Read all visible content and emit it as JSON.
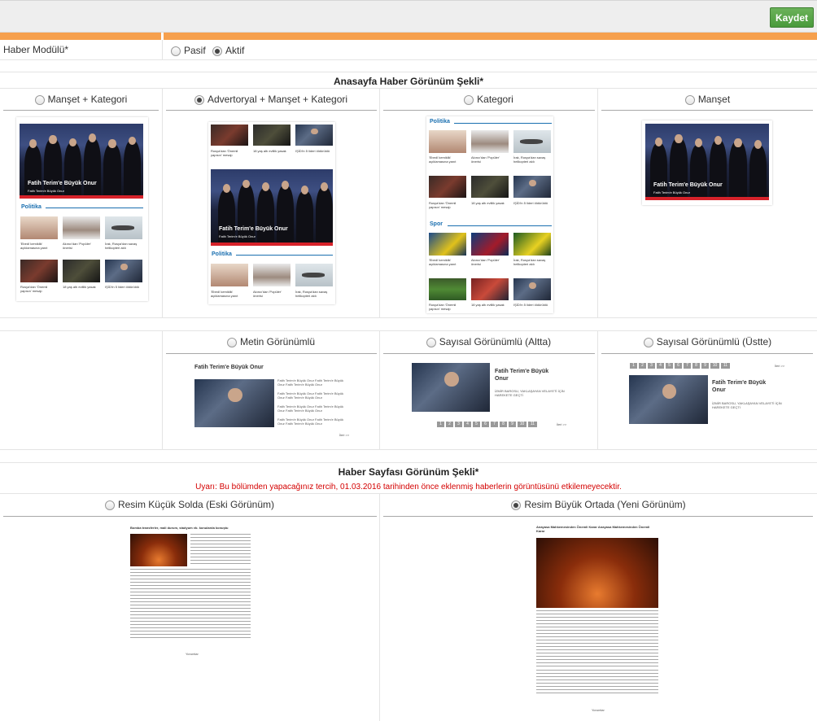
{
  "toolbar": {
    "save_label": "Kaydet"
  },
  "module": {
    "label": "Haber Modülü*",
    "options": [
      {
        "label": "Pasif",
        "selected": false
      },
      {
        "label": "Aktif",
        "selected": true
      }
    ]
  },
  "home_view": {
    "title": "Anasayfa Haber Görünüm Şekli*",
    "options": [
      {
        "label": "Manşet + Kategori",
        "selected": false
      },
      {
        "label": "Advertoryal + Manşet + Kategori",
        "selected": true
      },
      {
        "label": "Kategori",
        "selected": false
      },
      {
        "label": "Manşet",
        "selected": false
      }
    ],
    "preview": {
      "headline": "Fatih Terim'e Büyük Onur",
      "headline_sub": "Fatih Terim'e Büyük Onur",
      "categories": [
        "Politika",
        "Spor"
      ],
      "captions": [
        "'Ebedî kemiklik' açıklamasına yanıt",
        "Akıncı'dan 'Popüler' önerisi",
        "İrak, Rusya'dan savaş helikopteri aldı",
        "Rusya'dan 'Önemli yapısın' mesajı",
        "18 yaş altı evlilik yasak",
        "IŞİD'in 5 lideri öldürüldü"
      ]
    }
  },
  "pagination_view": {
    "options": [
      {
        "label": "Metin Görünümlü",
        "selected": false
      },
      {
        "label": "Sayısal Görünümlü (Altta)",
        "selected": false
      },
      {
        "label": "Sayısal Görünümlü (Üstte)",
        "selected": false
      }
    ],
    "preview": {
      "headline": "Fatih Terim'e Büyük Onur",
      "headline_two_line": [
        "Fatih Terim'e Büyük",
        "Onur"
      ],
      "list_item": "Fatih Terim'e Büyük Onur Fatih Terim'e Büyük Onur Fatih Terim'e Büyük Onur",
      "sub": "İZMİR BAROSU, YAKLAŞAYAN VELAYETİ İÇİN HAREKETE GEÇTİ",
      "next": "İleri >>",
      "pages": [
        "1",
        "2",
        "3",
        "4",
        "5",
        "6",
        "7",
        "8",
        "9",
        "10",
        "11"
      ]
    }
  },
  "news_page_view": {
    "title": "Haber Sayfası Görünüm Şekli*",
    "warning": "Uyarı: Bu bölümden yapacağınız tercih, 01.03.2016 tarihinden önce eklenmiş haberlerin görüntüsünü etkilemeyecektir.",
    "options": [
      {
        "label": "Resim Küçük Solda (Eski Görünüm)",
        "selected": false
      },
      {
        "label": "Resim Büyük Ortada (Yeni Görünüm)",
        "selected": true
      }
    ],
    "preview": {
      "left_headline": "Bomba transferler, mali durum, stadyum vb. konularda konuştu",
      "right_headline": "Anayasa Mahkemesinden Önemli Karar Anayasa Mahkemesinden Önemli Karar",
      "comments": "Yorumlar"
    }
  }
}
